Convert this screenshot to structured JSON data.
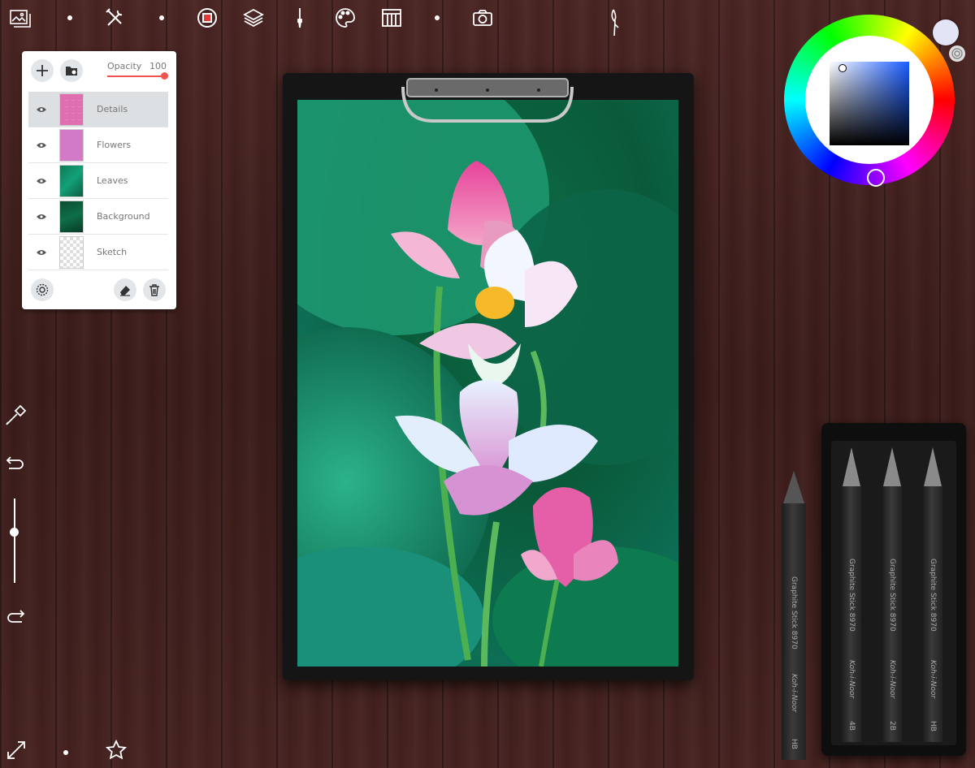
{
  "colors": {
    "accent": "#ef5350",
    "panel_bg": "#ffffff",
    "selected_row": "#dde0e3",
    "current_color": "#e3e4f5"
  },
  "toolbar": {
    "icons": [
      "gallery-icon",
      "tools-icon",
      "brush-settings-icon",
      "layers-icon",
      "brush-icon",
      "palette-icon",
      "reference-icon",
      "camera-icon",
      "pen-icon"
    ]
  },
  "layers_panel": {
    "opacity_label": "Opacity",
    "opacity_value": "100",
    "opacity_fraction": 1.0,
    "layers": [
      {
        "name": "Details",
        "selected": true
      },
      {
        "name": "Flowers",
        "selected": false
      },
      {
        "name": "Leaves",
        "selected": false
      },
      {
        "name": "Background",
        "selected": false
      },
      {
        "name": "Sketch",
        "selected": false
      }
    ]
  },
  "pencils": {
    "loose": {
      "label": "Graphite Stick 8970",
      "brand": "Koh-i-Noor",
      "grade": "HB"
    },
    "tray": [
      {
        "label": "Graphite Stick 8970",
        "brand": "Koh-i-Noor",
        "grade": "4B"
      },
      {
        "label": "Graphite Stick 8970",
        "brand": "Koh-i-Noor",
        "grade": "2B"
      },
      {
        "label": "Graphite Stick 8970",
        "brand": "Koh-i-Noor",
        "grade": "HB"
      }
    ]
  }
}
